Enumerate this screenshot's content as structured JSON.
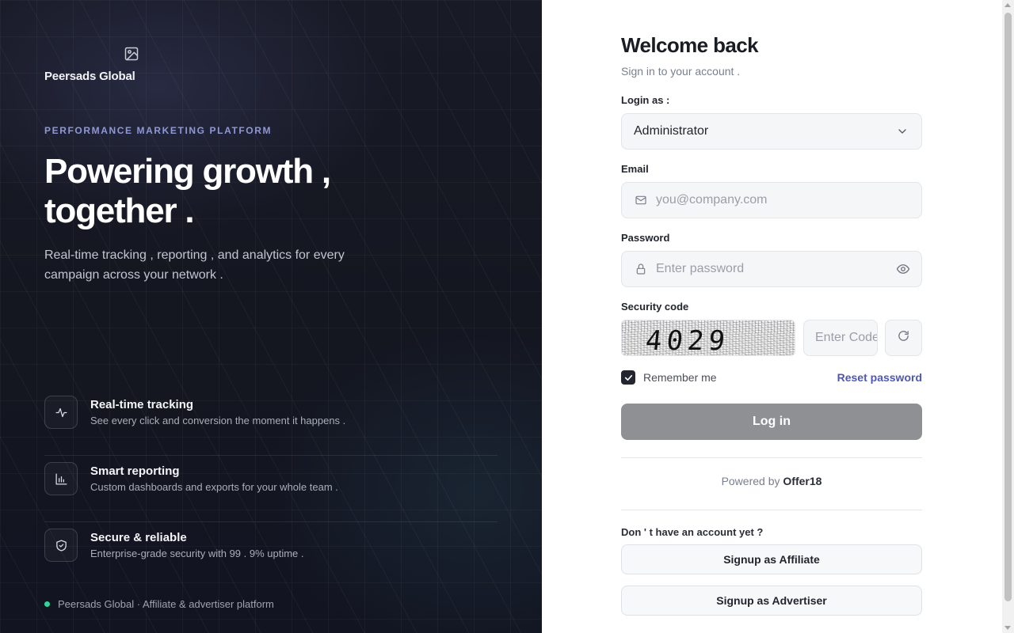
{
  "brand": {
    "name": "Peersads Global",
    "logo_icon": "image-icon"
  },
  "hero": {
    "eyebrow": "PERFORMANCE MARKETING PLATFORM",
    "headline_line1": "Powering growth ,",
    "headline_line2": "together .",
    "subtext": "Real-time tracking , reporting , and analytics for every campaign across your network ."
  },
  "features": [
    {
      "icon": "activity-icon",
      "title": "Real-time tracking",
      "description": "See every click and conversion the moment it happens ."
    },
    {
      "icon": "bar-chart-icon",
      "title": "Smart reporting",
      "description": "Custom dashboards and exports for your whole team ."
    },
    {
      "icon": "shield-check-icon",
      "title": "Secure & reliable",
      "description": "Enterprise-grade security with 99 . 9% uptime ."
    }
  ],
  "footer_note": "Peersads Global · Affiliate & advertiser platform",
  "form": {
    "title": "Welcome back",
    "subtitle": "Sign in to your account .",
    "login_as_label": "Login as :",
    "login_as_value": "Administrator",
    "email_label": "Email",
    "email_placeholder": "you@company.com",
    "password_label": "Password",
    "password_placeholder": "Enter password",
    "security_label": "Security code",
    "captcha_text": "4029",
    "captcha_placeholder": "Enter Code",
    "remember_label": "Remember me",
    "remember_checked": true,
    "reset_link": "Reset password",
    "login_button": "Log in",
    "powered_prefix": "Powered by",
    "powered_brand": "Offer18",
    "no_account": "Don ' t have an account yet ?",
    "signup_affiliate": "Signup as Affiliate",
    "signup_advertiser": "Signup as Advertiser"
  },
  "colors": {
    "accent_link": "#4c58b3",
    "eyebrow": "#8f97d6",
    "status_dot": "#34d399",
    "login_button_bg": "#8f9093"
  }
}
